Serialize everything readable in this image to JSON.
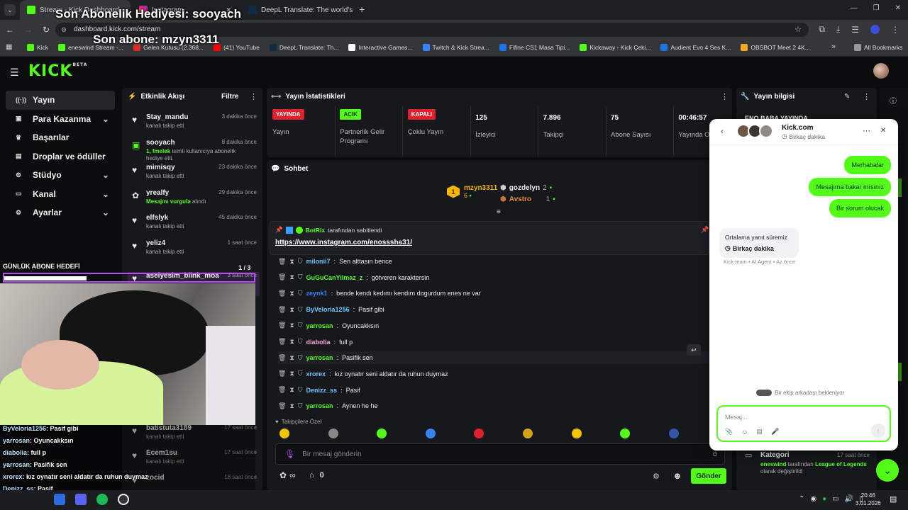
{
  "browser": {
    "tabs": [
      {
        "title": "Stream - Kick Dashboard"
      },
      {
        "title": "Instagram"
      },
      {
        "title": "DeepL Translate: The world's m..."
      }
    ],
    "new_tab": "+",
    "url": "dashboard.kick.com/stream",
    "bookmarks": [
      "Kick",
      "eneswind Stream -...",
      "Gelen Kutusu (2.368...",
      "(41) YouTube",
      "DeepL Translate: Th...",
      "Interactive Games...",
      "Twitch & Kick Strea...",
      "Fifine CS1 Masa Tipi...",
      "Kickaway - Kick Çeki...",
      "Audient Evo 4 Ses K...",
      "OBSBOT Meet 2 4K..."
    ],
    "all_bookmarks": "All Bookmarks",
    "more_bookmarks": "»"
  },
  "overlay": {
    "last_gift": "Son Abonelik Hediyesi: sooyach",
    "last_sub": "Son abone: mzyn3311",
    "daily_goal": "GÜNLÜK ABONE HEDEFİ",
    "chat": [
      {
        "user": "ByVeloria1256",
        "msg": "Pasif gibi"
      },
      {
        "user": "yarrosan",
        "msg": "Oyuncakksın"
      },
      {
        "user": "diabolia",
        "msg": "full p"
      },
      {
        "user": "yarrosan",
        "msg": "Pasifik sen"
      },
      {
        "user": "xrorex",
        "msg": "kız oynatır seni aldatır da ruhun duymaz"
      },
      {
        "user": "Denizz_ss",
        "msg": "Pasif"
      },
      {
        "user": "yarrosan",
        "msg": "Aynen he he"
      }
    ]
  },
  "brand": {
    "logo": "KICK",
    "beta": "BETA",
    "accent": "#53fc18"
  },
  "sidebar": {
    "items": [
      {
        "label": "Yayın",
        "icon": "broadcast-icon"
      },
      {
        "label": "Para Kazanma",
        "icon": "money-icon"
      },
      {
        "label": "Başarılar",
        "icon": "trophy-icon"
      },
      {
        "label": "Droplar ve ödüller",
        "icon": "gift-icon"
      },
      {
        "label": "Stüdyo",
        "icon": "studio-icon"
      },
      {
        "label": "Kanal",
        "icon": "channel-icon"
      },
      {
        "label": "Ayarlar",
        "icon": "gear-icon"
      }
    ]
  },
  "activity": {
    "title": "Etkinlik Akışı",
    "filter": "Filtre",
    "pager": "1 / 3",
    "events": [
      {
        "name": "Stay_mandu",
        "time": "3 dakika önce",
        "desc": "kanalı takip etti",
        "hl": ""
      },
      {
        "name": "sooyach",
        "time": "8 dakika önce",
        "desc": " isimli kullanıcıya abonelik hediye etti.",
        "hl": "1, fmelek"
      },
      {
        "name": "mimisqy",
        "time": "23 dakika önce",
        "desc": "kanalı takip etti",
        "hl": ""
      },
      {
        "name": "yrealfy",
        "time": "29 dakika önce",
        "desc": " alındı",
        "hl": "Mesajını vurgula"
      },
      {
        "name": "elfslyk",
        "time": "45 dakika önce",
        "desc": "kanalı takip etti",
        "hl": ""
      },
      {
        "name": "yeliz4",
        "time": "1 saat önce",
        "desc": "kanalı takip etti",
        "hl": ""
      },
      {
        "name": "aselyesim_blink_moa",
        "time": "3 saat önce",
        "desc": "",
        "hl": ""
      },
      {
        "name": "batistuta3189",
        "time": "17 saat önce",
        "desc": "kanalı takip etti",
        "hl": ""
      },
      {
        "name": "Ecem1su",
        "time": "17 saat önce",
        "desc": "kanalı takip etti",
        "hl": ""
      },
      {
        "name": "zocid",
        "time": "18 saat önce",
        "desc": "",
        "hl": ""
      }
    ]
  },
  "stats": {
    "title": "Yayın İstatistikleri",
    "items": [
      {
        "badge": "YAYINDA",
        "label": "Yayın",
        "color": "#e0202c",
        "text": "#ffffff"
      },
      {
        "badge": "AÇIK",
        "label": "Partnerlik Gelir Programı",
        "color": "#53fc18",
        "text": "#0b3a06"
      },
      {
        "badge": "KAPALI",
        "label": "Çoklu Yayın",
        "color": "#e0202c",
        "text": "#ffffff"
      },
      {
        "value": "125",
        "label": "İzleyici"
      },
      {
        "value": "7.896",
        "label": "Takipçi"
      },
      {
        "value": "75",
        "label": "Abone Sayısı"
      },
      {
        "value": "00:46:57",
        "label": "Yayında Olma Süre"
      }
    ]
  },
  "chat": {
    "title": "Sohbet",
    "top": [
      {
        "rank": "1",
        "user": "mzyn3311",
        "count": "6"
      },
      {
        "user": "gozdelyn",
        "count": "2"
      },
      {
        "user": "Avstro",
        "count": "1"
      }
    ],
    "pinned_by": "BotRix",
    "pinned_suffix": "tarafından sabitlendi",
    "pinned_link": "https://www.instagram.com/enosssha31/",
    "messages": [
      {
        "user": "milonii7",
        "msg": "Sen alttasın bence",
        "color": "#6ec6ff"
      },
      {
        "user": "GuGuCanYilmaz_z",
        "msg": "götveren karaktersin",
        "color": "#53fc18"
      },
      {
        "user": "zeynk1",
        "msg": "bende kendı kedımı kendım dogurdum enes ne var",
        "color": "#3b82f6"
      },
      {
        "user": "ByVeloria1256",
        "msg": "Pasif gibi",
        "color": "#6ec6ff"
      },
      {
        "user": "yarrosan",
        "msg": "Oyuncakksın",
        "color": "#53fc18"
      },
      {
        "user": "diabolia",
        "msg": "full p",
        "color": "#f9a8d4"
      },
      {
        "user": "yarrosan",
        "msg": "Pasifik sen",
        "color": "#53fc18"
      },
      {
        "user": "xrorex",
        "msg": "kız oynatır seni aldatır da ruhun duymaz",
        "color": "#6ec6ff"
      },
      {
        "user": "Denizz_ss",
        "msg": "Pasif",
        "color": "#6ec6ff"
      },
      {
        "user": "yarrosan",
        "msg": "Aynen he he",
        "color": "#53fc18"
      }
    ],
    "emote_label": "Takipçilere Özel",
    "input_placeholder": "Bir mesaj gönderin",
    "infinity": "∞",
    "points": "0",
    "send": "Gönder"
  },
  "info": {
    "title": "Yayın bilgisi",
    "live_text": "ENO BABA YAYINDA",
    "category_title": "Kategori",
    "category_time": "17 saat önce",
    "category_user": "eneswind",
    "category_mid": " tarafından ",
    "category_game": "League of Legends",
    "category_end": " olarak değiştirildi"
  },
  "support": {
    "title": "Kick.com",
    "status": "Birkaç dakika",
    "user_msgs": [
      "Merhabalar",
      "Mesajıma bakar mısınız",
      "Bir sorum olucak"
    ],
    "bot_title": "Ortalama yanıt süremiz",
    "bot_value": "Birkaç dakika",
    "meta": "Kick team • AI Agent • Az önce",
    "waiting": "Bir ekip arkadaşı bekleniyor",
    "placeholder": "Mesaj..."
  },
  "taskbar": {
    "time": "20:46",
    "date": "3.01.2026"
  }
}
